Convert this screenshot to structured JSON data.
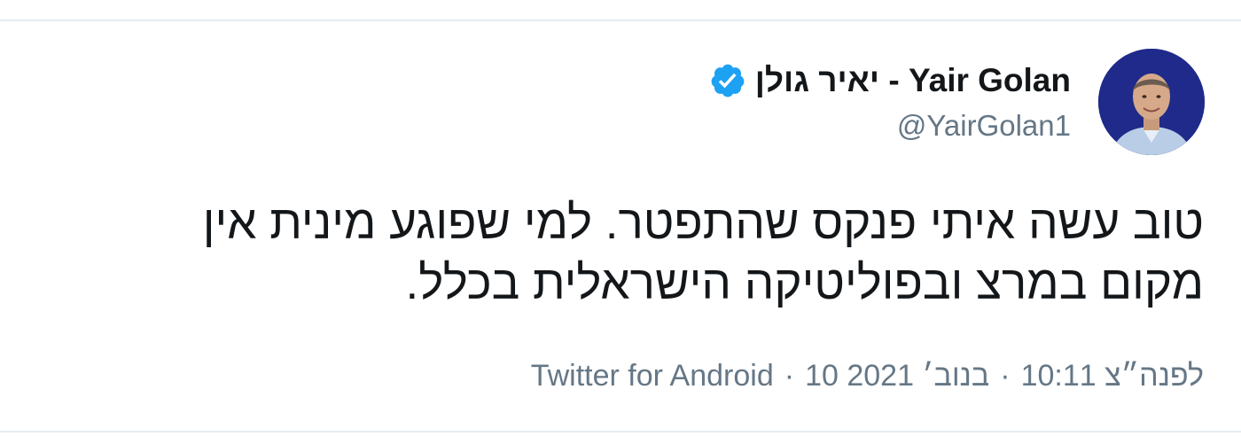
{
  "tweet": {
    "author": {
      "display_name": "יאיר גולן - Yair Golan",
      "handle": "@YairGolan1",
      "verified": true,
      "avatar_icon": "profile-photo"
    },
    "text_lines": [
      "טוב עשה איתי פנקס שהתפטר. למי שפוגע מינית אין",
      "מקום במרצ ובפוליטיקה הישראלית בכלל."
    ],
    "meta": {
      "time": "10:11 לפנה״צ",
      "separator": "·",
      "date": "10 בנוב׳ 2021",
      "source": "Twitter for Android"
    }
  },
  "colors": {
    "primary_text": "#14171a",
    "secondary_text": "#657786",
    "verified_blue": "#1da1f2",
    "divider": "#e6ecf0"
  }
}
